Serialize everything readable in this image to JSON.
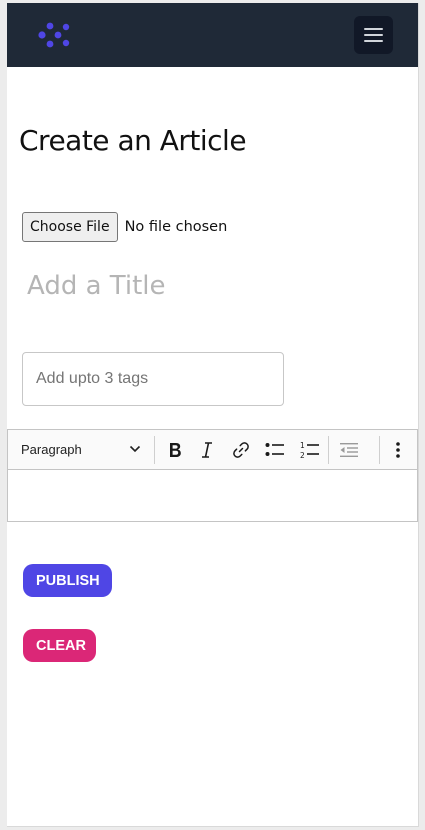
{
  "header": {
    "logo_icon": "brand-logo-icon",
    "menu_icon": "hamburger-menu-icon",
    "brand_color": "#4f46e5",
    "background": "#1f2937"
  },
  "page": {
    "title": "Create an Article"
  },
  "file_upload": {
    "button_label": "Choose File",
    "status": "No file chosen"
  },
  "title_field": {
    "placeholder": "Add a Title",
    "value": ""
  },
  "tags_field": {
    "placeholder": "Add upto 3 tags",
    "value": ""
  },
  "editor": {
    "block_type": "Paragraph",
    "toolbar_icons": [
      "chevron-down-icon",
      "bold-icon",
      "italic-icon",
      "link-icon",
      "bulleted-list-icon",
      "numbered-list-icon",
      "outdent-icon",
      "more-options-icon"
    ],
    "content": ""
  },
  "actions": {
    "publish_label": "PUBLISH",
    "publish_color": "#4f46e5",
    "clear_label": "CLEAR",
    "clear_color": "#db2777"
  }
}
